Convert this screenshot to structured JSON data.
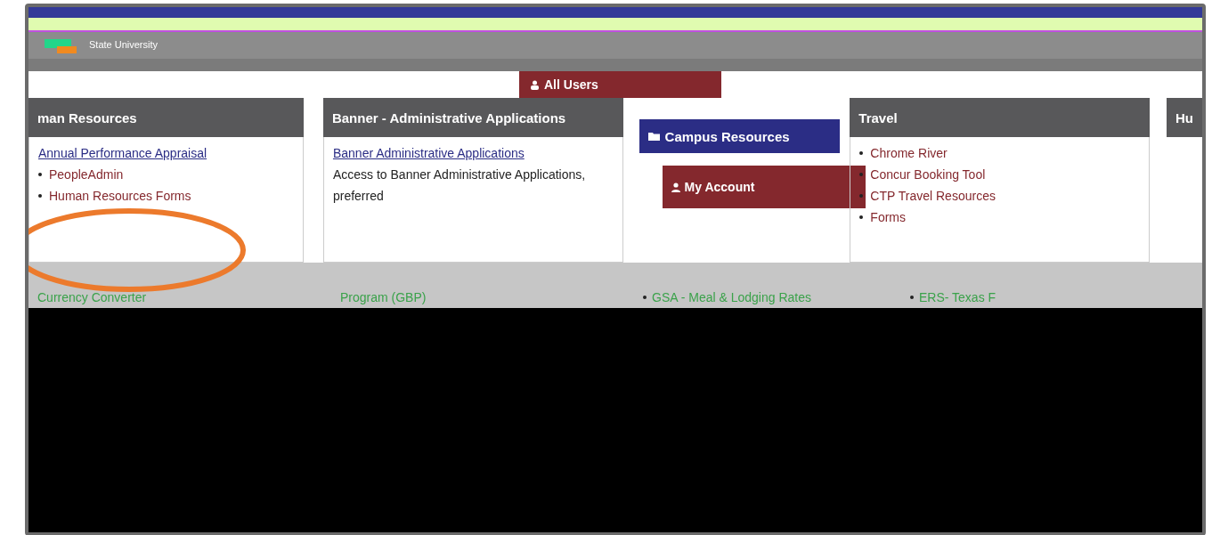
{
  "header": {
    "university": "State University"
  },
  "all_users": {
    "label": "All Users"
  },
  "panels": [
    {
      "title": "man Resources",
      "kind": "gray",
      "items": [
        {
          "text": "Annual Performance Appraisal",
          "kind": "link"
        },
        {
          "text": "PeopleAdmin",
          "kind": "bullet"
        },
        {
          "text": "Human Resources Forms",
          "kind": "bullet"
        }
      ]
    },
    {
      "title": "Banner - Administrative Applications",
      "kind": "gray",
      "items": [
        {
          "text": "Banner Administrative Applications",
          "kind": "link"
        },
        {
          "text": "Access to Banner Administrative Applications,",
          "kind": "text"
        },
        {
          "text": "preferred",
          "kind": "text"
        }
      ]
    },
    {
      "title": "Campus Resources",
      "kind": "navy"
    },
    {
      "title": "Travel",
      "kind": "gray",
      "items": [
        {
          "text": "Chrome River",
          "kind": "bullet"
        },
        {
          "text": "Concur Booking Tool",
          "kind": "bullet"
        },
        {
          "text": "CTP Travel Resources",
          "kind": "bullet"
        },
        {
          "text": "Forms",
          "kind": "bullet"
        }
      ]
    },
    {
      "title": "Hu",
      "kind": "gray"
    }
  ],
  "my_account": {
    "label": "My Account"
  },
  "bottom_links": [
    {
      "text": "Currency Converter",
      "bullet": false
    },
    {
      "text": "Program (GBP)",
      "bullet": false
    },
    {
      "text": "GSA - Meal & Lodging Rates",
      "bullet": true
    },
    {
      "text": "ERS- Texas F",
      "bullet": true
    }
  ]
}
